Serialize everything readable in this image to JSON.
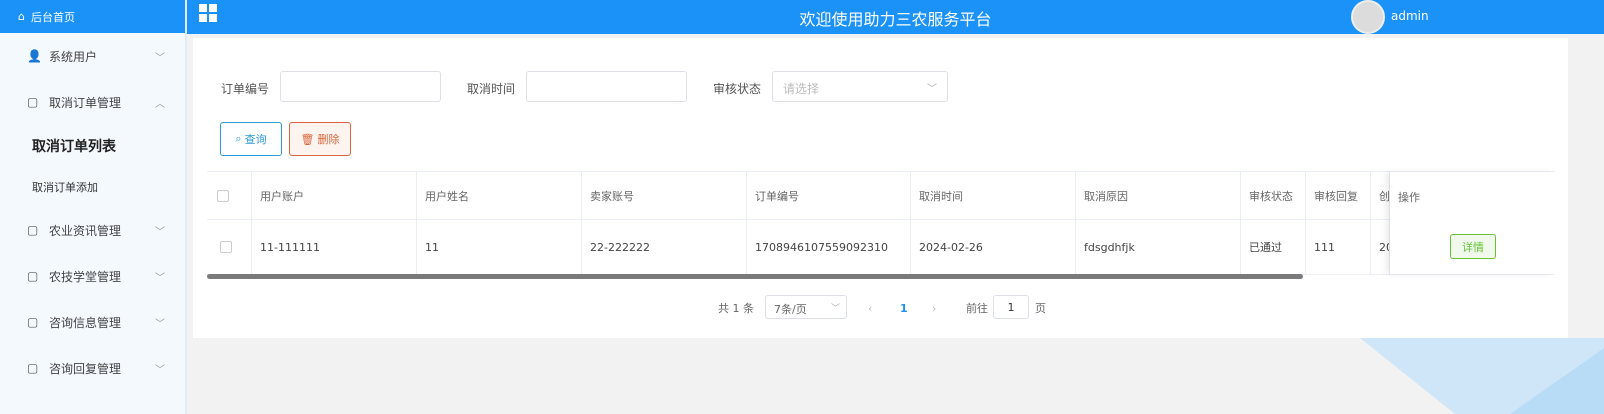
{
  "sidebar": {
    "home_label": "后台首页",
    "items": [
      {
        "label": "系统用户"
      },
      {
        "label": "取消订单管理"
      },
      {
        "label": "农业资讯管理"
      },
      {
        "label": "农技学堂管理"
      },
      {
        "label": "咨询信息管理"
      },
      {
        "label": "咨询回复管理"
      }
    ],
    "sub_items": [
      {
        "label": "取消订单列表"
      },
      {
        "label": "取消订单添加"
      }
    ]
  },
  "header": {
    "title": "欢迎使用助力三农服务平台",
    "username": "admin"
  },
  "filters": {
    "order_no_label": "订单编号",
    "order_no_value": "",
    "cancel_time_label": "取消时间",
    "cancel_time_value": "",
    "review_status_label": "审核状态",
    "review_status_placeholder": "请选择"
  },
  "toolbar": {
    "search_label": "查询",
    "delete_label": "删除"
  },
  "table": {
    "columns": [
      "用户账户",
      "用户姓名",
      "卖家账号",
      "订单编号",
      "取消时间",
      "取消原因",
      "审核状态",
      "审核回复",
      "创",
      "操作"
    ],
    "rows": [
      {
        "cells": [
          "11-111111",
          "11",
          "22-222222",
          "1708946107559092310",
          "2024-02-26",
          "fdsgdhfjk",
          "已通过",
          "111",
          "20"
        ],
        "action": "详情"
      }
    ]
  },
  "pagination": {
    "total_text": "共 1 条",
    "page_size": "7条/页",
    "current_page": "1",
    "goto_label": "前往",
    "goto_value": "1",
    "page_suffix": "页"
  },
  "colors": {
    "brand": "#1a92f8",
    "search": "#2d9ad8",
    "delete": "#d9653d",
    "success": "#67c23a"
  }
}
